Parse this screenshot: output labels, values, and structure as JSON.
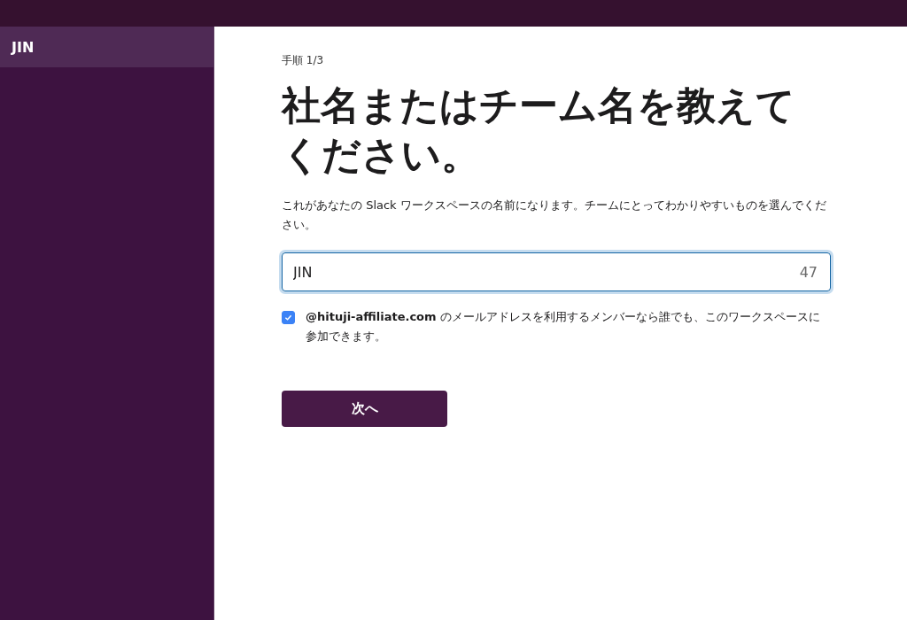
{
  "sidebar": {
    "items": [
      {
        "label": "JIN",
        "selected": true
      }
    ]
  },
  "step": "手順 1/3",
  "heading": "社名またはチーム名を教えてください。",
  "description": "これがあなたの Slack ワークスペースの名前になります。チームにとってわかりやすいものを選んでください。",
  "name_field": {
    "value": "JIN",
    "counter": "47",
    "focused": true
  },
  "domain_option": {
    "label": "**@hituji-affiliate.com** のメールアドレスを利用するメンバーなら誰でも、このワークスペースに参加できます。",
    "checked": true
  },
  "buttons": [
    {
      "label": "次へ"
    }
  ]
}
